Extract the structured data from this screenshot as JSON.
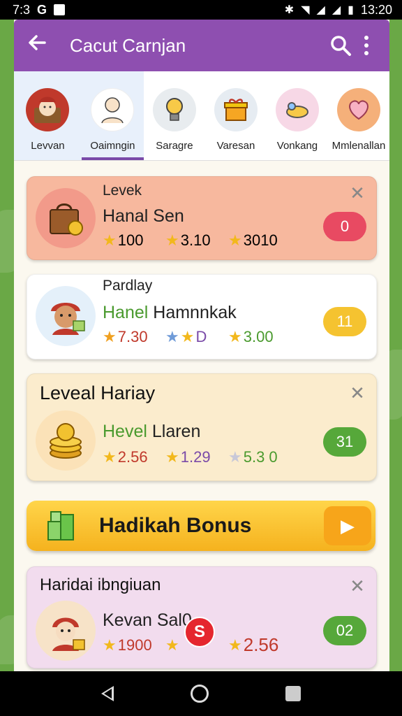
{
  "status_bar": {
    "time_left": "7:3",
    "g_label": "G",
    "time_right": "13:20"
  },
  "app_bar": {
    "title": "Cacut Carnjan",
    "back_icon": "arrow-left-icon",
    "search_icon": "search-icon",
    "more_icon": "more-vert-icon"
  },
  "categories": [
    {
      "label": "Levvan",
      "icon": "chest-icon",
      "color": "#c0392b"
    },
    {
      "label": "Oaimngin",
      "icon": "person-icon",
      "color": "#f4e4cf"
    },
    {
      "label": "Saragre",
      "icon": "lightbulb-icon",
      "color": "#e8ecef"
    },
    {
      "label": "Varesan",
      "icon": "gift-icon",
      "color": "#e6ecf2"
    },
    {
      "label": "Vonkang",
      "icon": "toy-icon",
      "color": "#f7d8e6"
    },
    {
      "label": "Mmlenallan",
      "icon": "heart-icon",
      "color": "#f5b07a"
    }
  ],
  "cards": [
    {
      "tag": "Levek",
      "name_a": "Hanal Sen",
      "name_b": "",
      "stats": [
        "100",
        "3.10",
        "3010"
      ],
      "badge": "0",
      "badge_color": "#e84a62",
      "bg": "#f7b89e",
      "avatar_bg": "#f29a8a"
    },
    {
      "tag": "Pardlay",
      "name_a": "Hanel",
      "name_b": " Hamnnkak",
      "stats": [
        "7.30",
        "D",
        "3.00"
      ],
      "badge": "11",
      "badge_color": "#f5c330",
      "bg": "#ffffff",
      "avatar_bg": "#e4f0fa"
    },
    {
      "title": "Leveal Hariay",
      "name_a": "Hevel",
      "name_b": " Llaren",
      "stats": [
        "2.56",
        "1.29",
        "5.3 0"
      ],
      "badge": "31",
      "badge_color": "#56a83a",
      "bg": "#fbeccd",
      "avatar_bg": "#fbe2b8"
    },
    {
      "title": "Haridai ibngiuan",
      "name_a": "Kevan Sal0",
      "name_b": "",
      "stats": [
        "1900",
        "",
        "2.56"
      ],
      "badge": "02",
      "badge_color": "#56a83a",
      "bg": "#f2dcee",
      "avatar_bg": "#f7e3c8"
    }
  ],
  "bonus": {
    "label": "Hadikah Bonus",
    "icon": "boxes-icon",
    "play_icon": "play-icon"
  },
  "red_fab": "S"
}
